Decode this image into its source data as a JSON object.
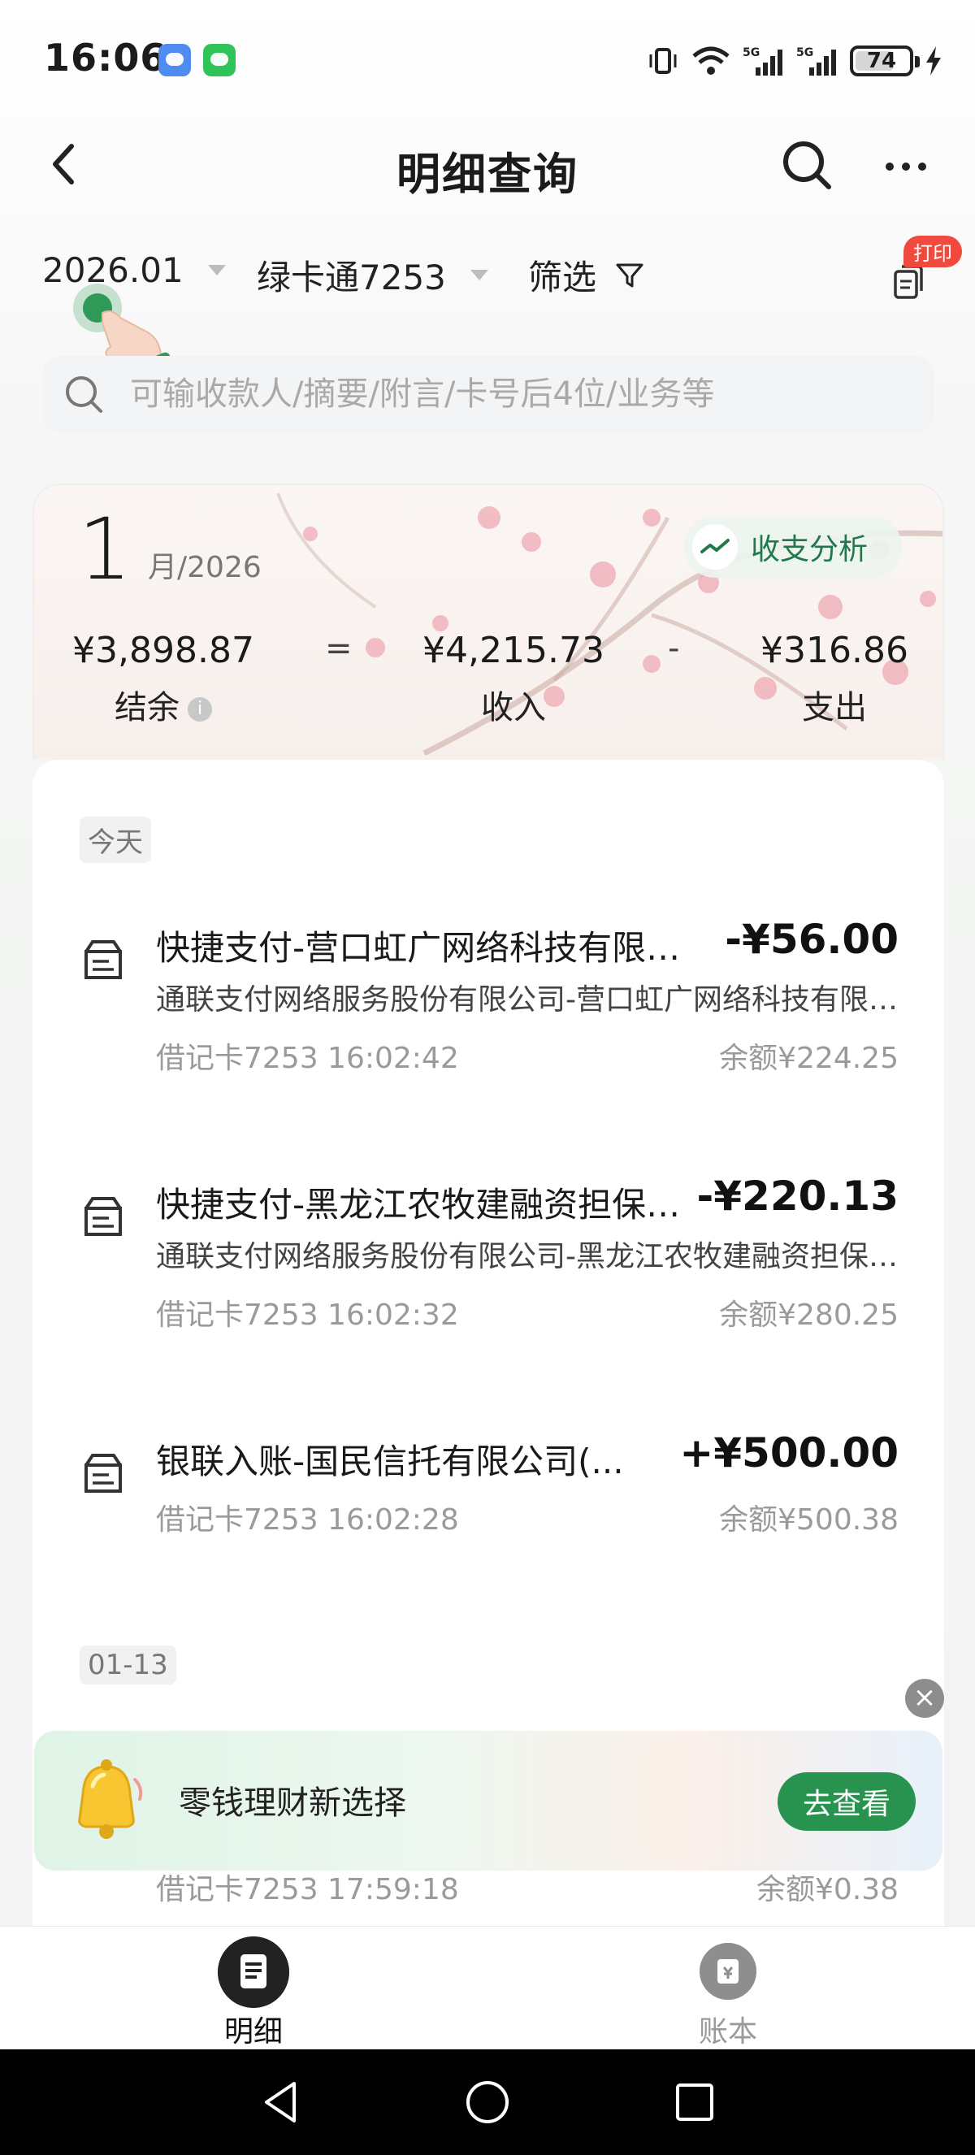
{
  "status_bar": {
    "time": "16:06",
    "battery": "74",
    "battery_level": 0.74,
    "network": "5G"
  },
  "header": {
    "title": "明细查询",
    "back_icon": "chevron-left-icon",
    "search_icon": "search-icon",
    "more_icon": "more-horizontal-icon"
  },
  "filters": {
    "month": "2026.01",
    "card": "绿卡通7253",
    "filter_label": "筛选",
    "print_badge": "打印"
  },
  "search": {
    "placeholder": "可输收款人/摘要/附言/卡号后4位/业务等"
  },
  "summary": {
    "month": "1",
    "month_year": "月/2026",
    "analysis_label": "收支分析",
    "balance": "¥3,898.87",
    "balance_label": "结余",
    "equals": "=",
    "income": "¥4,215.73",
    "income_label": "收入",
    "minus": "-",
    "expense": "¥316.86",
    "expense_label": "支出"
  },
  "groups": [
    {
      "date_label": "今天",
      "transactions": [
        {
          "title": "快捷支付-营口虹广网络科技有限公司",
          "amount": "-¥56.00",
          "description": "通联支付网络服务股份有限公司-营口虹广网络科技有限公司",
          "meta": "借记卡7253 16:02:42",
          "balance": "余额¥224.25"
        },
        {
          "title": "快捷支付-黑龙江农牧建融资担保有限公司",
          "amount": "-¥220.13",
          "description": "通联支付网络服务股份有限公司-黑龙江农牧建融资担保有限公司",
          "meta": "借记卡7253 16:02:32",
          "balance": "余额¥280.25"
        },
        {
          "title": "银联入账-国民信托有限公司(...",
          "amount": "+¥500.00",
          "description": "",
          "meta": "借记卡7253 16:02:28",
          "balance": "余额¥500.38"
        }
      ]
    },
    {
      "date_label": "01-13",
      "transactions": [
        {
          "meta": "借记卡7253 17:59:18",
          "balance": "余额¥0.38"
        }
      ]
    }
  ],
  "promo": {
    "text": "零钱理财新选择",
    "button": "去查看",
    "close": "×"
  },
  "bottom_nav": {
    "detail": "明细",
    "ledger": "账本"
  },
  "colors": {
    "accent": "#27934f",
    "badge": "#f04a3e",
    "analysis_text": "#21784a"
  }
}
